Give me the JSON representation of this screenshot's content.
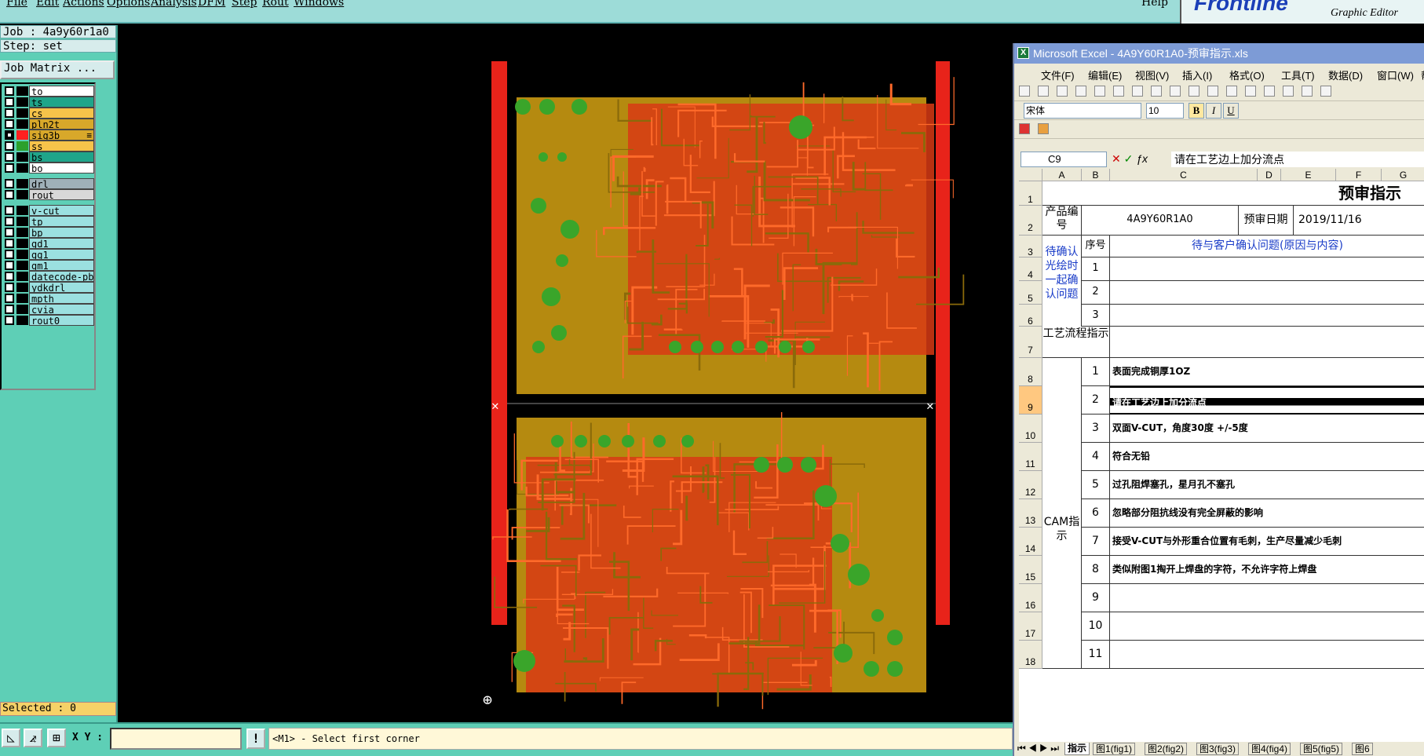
{
  "menubar": {
    "items": [
      "File",
      "Edit",
      "Actions",
      "Options",
      "Analysis",
      "DFM",
      "Step",
      "Rout",
      "Windows"
    ],
    "help": "Help",
    "logo": "Frontline",
    "logo_subtitle": "Graphic Editor"
  },
  "job": {
    "label": "Job : 4a9y60r1a0",
    "step": "Step: set",
    "matrix_button": "Job Matrix ..."
  },
  "layers": [
    {
      "name": "to",
      "color": "#ffffff",
      "swatch": "#000000",
      "checked": false
    },
    {
      "name": "ts",
      "color": "#1fa58a",
      "swatch": "#000000",
      "checked": false
    },
    {
      "name": "cs",
      "color": "#f6c34a",
      "swatch": "#000000",
      "checked": false
    },
    {
      "name": "pln2t",
      "color": "#d8a82a",
      "swatch": "#000000",
      "checked": false
    },
    {
      "name": "sig3b",
      "color": "#d8a82a",
      "swatch": "#ff2020",
      "checked": true,
      "mark": "≡"
    },
    {
      "name": "ss",
      "color": "#f6c34a",
      "swatch": "#2ca02c",
      "checked": false
    },
    {
      "name": "bs",
      "color": "#1fa58a",
      "swatch": "#000000",
      "checked": false
    },
    {
      "name": "bo",
      "color": "#ffffff",
      "swatch": "#000000",
      "checked": false
    },
    {
      "name": "drl",
      "color": "#9fb0b8",
      "swatch": "#000000",
      "checked": false
    },
    {
      "name": "rout",
      "color": "#d8d8d8",
      "swatch": "#000000",
      "checked": false
    },
    {
      "name": "v-cut",
      "color": "#9be0e0",
      "swatch": "#000000",
      "checked": false
    },
    {
      "name": "tp",
      "color": "#9be0e0",
      "swatch": "#000000",
      "checked": false
    },
    {
      "name": "bp",
      "color": "#9be0e0",
      "swatch": "#000000",
      "checked": false
    },
    {
      "name": "gd1",
      "color": "#9be0e0",
      "swatch": "#000000",
      "checked": false
    },
    {
      "name": "gg1",
      "color": "#9be0e0",
      "swatch": "#000000",
      "checked": false
    },
    {
      "name": "gm1",
      "color": "#9be0e0",
      "swatch": "#000000",
      "checked": false
    },
    {
      "name": "datecode-pbo",
      "color": "#9be0e0",
      "swatch": "#000000",
      "checked": false
    },
    {
      "name": "ydkdrl",
      "color": "#9be0e0",
      "swatch": "#000000",
      "checked": false
    },
    {
      "name": "mpth",
      "color": "#9be0e0",
      "swatch": "#000000",
      "checked": false
    },
    {
      "name": "cvia",
      "color": "#9be0e0",
      "swatch": "#000000",
      "checked": false
    },
    {
      "name": "rout0",
      "color": "#9be0e0",
      "swatch": "#000000",
      "checked": false
    }
  ],
  "selected": "Selected : 0",
  "bottom": {
    "xy_label": "X Y :",
    "xy_value": "",
    "prompt": "<M1> - Select first corner",
    "warn": "!"
  },
  "excel": {
    "title": "Microsoft Excel - 4A9Y60R1A0-预审指示.xls",
    "menu": [
      "文件(F)",
      "编辑(E)",
      "视图(V)",
      "插入(I)",
      "格式(O)",
      "工具(T)",
      "数据(D)",
      "窗口(W)",
      "帮助(H)"
    ],
    "font": "宋体",
    "size": "10",
    "bold": "B",
    "italic": "I",
    "underline": "U",
    "cell_ref": "C9",
    "formula": "请在工艺边上加分流点",
    "columns": [
      "A",
      "B",
      "C",
      "D",
      "E",
      "F",
      "G"
    ],
    "rows": [
      "1",
      "2",
      "3",
      "4",
      "5",
      "6",
      "7",
      "8",
      "9",
      "10",
      "11",
      "12",
      "13",
      "14",
      "15",
      "16",
      "17",
      "18"
    ],
    "sheet_title": "预审指示",
    "product_label": "产品编号",
    "product_no": "4A9Y60R1A0",
    "date_label": "预审日期",
    "date": "2019/11/16",
    "seq_label": "序号",
    "confirm_header": "待与客户确认问题(原因与内容)",
    "confirm_label": "待确认光绘时一起确认问题",
    "confirm_nums": [
      "1",
      "2",
      "3"
    ],
    "process_label": "工艺流程指示",
    "cam_label": "CAM指示",
    "cam_items": [
      {
        "no": "1",
        "text": "表面完成铜厚1OZ"
      },
      {
        "no": "2",
        "text": "请在工艺边上加分流点"
      },
      {
        "no": "3",
        "text": "双面V-CUT，角度30度 +/-5度"
      },
      {
        "no": "4",
        "text": "符合无铅"
      },
      {
        "no": "5",
        "text": "过孔阻焊塞孔，星月孔不塞孔"
      },
      {
        "no": "6",
        "text": "忽略部分阻抗线没有完全屏蔽的影响"
      },
      {
        "no": "7",
        "text": "接受V-CUT与外形重合位置有毛刺，生产尽量减少毛刺"
      },
      {
        "no": "8",
        "text": "类似附图1掏开上焊盘的字符，不允许字符上焊盘"
      },
      {
        "no": "9",
        "text": ""
      },
      {
        "no": "10",
        "text": ""
      },
      {
        "no": "11",
        "text": ""
      }
    ],
    "tabs": [
      "指示",
      "图1(fig1)",
      "图2(fig2)",
      "图3(fig3)",
      "图4(fig4)",
      "图5(fig5)",
      "图6"
    ]
  }
}
